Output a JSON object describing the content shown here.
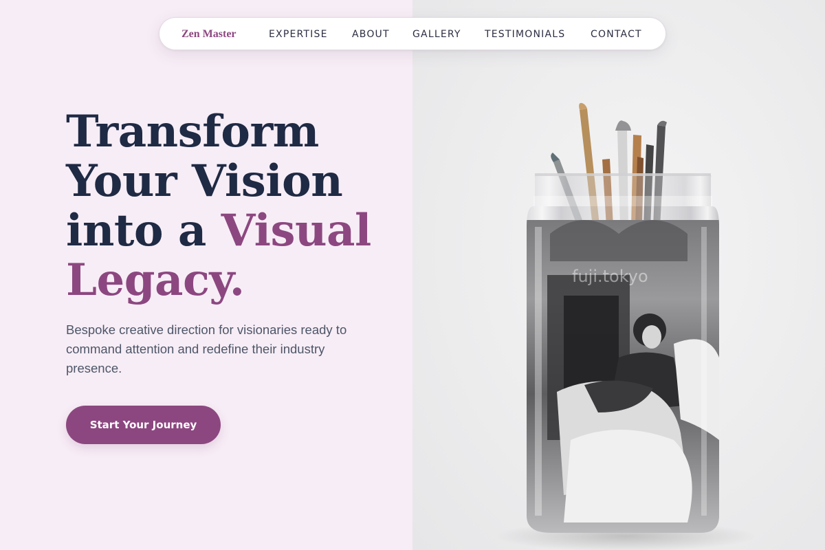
{
  "nav": {
    "brand": "Zen Master",
    "links": [
      "EXPERTISE",
      "ABOUT",
      "GALLERY",
      "TESTIMONIALS",
      "CONTACT"
    ]
  },
  "hero": {
    "headline": {
      "line1": "Transform",
      "line2": "Your Vision",
      "line3_plain": "into a ",
      "line3_accent": "Visual",
      "line4_accent": "Legacy."
    },
    "subcopy": "Bespoke creative direction for visionaries ready to command attention and redefine their industry presence.",
    "cta_label": "Start Your Journey"
  },
  "image": {
    "watermark": "fuji.tokyo"
  },
  "colors": {
    "accent": "#8c4780",
    "heading": "#1f2a44",
    "body_text": "#4d5668",
    "left_bg": "#f7edf6",
    "right_bg": "#ececed"
  }
}
